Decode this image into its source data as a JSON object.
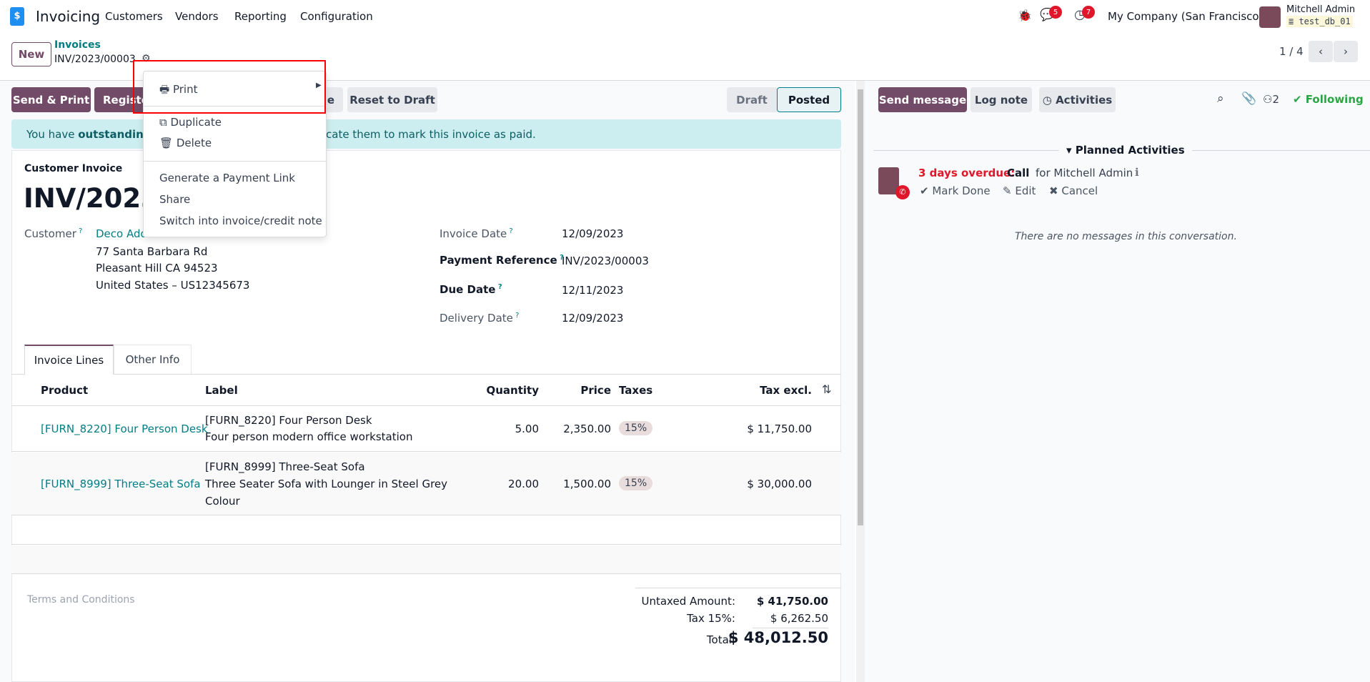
{
  "nav": {
    "app": "Invoicing",
    "menu": [
      "Customers",
      "Vendors",
      "Reporting",
      "Configuration"
    ],
    "chat_count": "5",
    "activity_count": "7",
    "company": "My Company (San Francisco)",
    "user": "Mitchell Admin",
    "db": "test_db_01"
  },
  "control": {
    "new": "New",
    "breadcrumb": "Invoices",
    "record": "INV/2023/00003",
    "pager": "1 / 4"
  },
  "actions": {
    "send_print": "Send & Print",
    "register": "Registe",
    "third": "ce",
    "reset": "Reset to Draft"
  },
  "status": {
    "items": [
      "Draft",
      "Posted"
    ],
    "active": "Posted"
  },
  "alert": {
    "pre": "You have ",
    "bold": "outstanding c",
    "post": "cate them to mark this invoice as paid."
  },
  "menu": {
    "print": "Print",
    "duplicate": "Duplicate",
    "delete": "Delete",
    "payment_link": "Generate a Payment Link",
    "share": "Share",
    "switch": "Switch into invoice/credit note"
  },
  "form": {
    "type": "Customer Invoice",
    "name": "INV/2023/",
    "customer_label": "Customer",
    "customer": "Deco Add",
    "address": [
      "77 Santa Barbara Rd",
      "Pleasant Hill CA 94523",
      "United States – US12345673"
    ],
    "fields": [
      {
        "label": "Invoice Date",
        "value": "12/09/2023",
        "bold": false
      },
      {
        "label": "Payment Reference",
        "value": "INV/2023/00003",
        "bold": true
      },
      {
        "label": "Due Date",
        "value": "12/11/2023",
        "bold": true
      },
      {
        "label": "Delivery Date",
        "value": "12/09/2023",
        "bold": false
      }
    ]
  },
  "tabs": [
    "Invoice Lines",
    "Other Info"
  ],
  "table": {
    "headers": {
      "product": "Product",
      "label": "Label",
      "quantity": "Quantity",
      "price": "Price",
      "taxes": "Taxes",
      "tax_excl": "Tax excl."
    },
    "rows": [
      {
        "product": "[FURN_8220] Four Person Desk",
        "label": [
          "[FURN_8220] Four Person Desk",
          "Four person modern office workstation"
        ],
        "quantity": "5.00",
        "price": "2,350.00",
        "tax": "15%",
        "subtotal": "$ 11,750.00"
      },
      {
        "product": "[FURN_8999] Three-Seat Sofa",
        "label": [
          "[FURN_8999] Three-Seat Sofa",
          "Three Seater Sofa with Lounger in Steel Grey",
          "Colour"
        ],
        "quantity": "20.00",
        "price": "1,500.00",
        "tax": "15%",
        "subtotal": "$ 30,000.00"
      }
    ]
  },
  "terms": "Terms and Conditions",
  "totals": {
    "untaxed_label": "Untaxed Amount:",
    "untaxed": "$ 41,750.00",
    "tax_label": "Tax 15%:",
    "tax": "$ 6,262.50",
    "total_label": "Total:",
    "total": "$ 48,012.50"
  },
  "chatter": {
    "send": "Send message",
    "log": "Log note",
    "activities": "Activities",
    "followers": "2",
    "following": "Following",
    "planned": "Planned Activities",
    "overdue": "3 days overdue:",
    "activity_type": "Call",
    "for": "for Mitchell Admin",
    "mark_done": "Mark Done",
    "edit": "Edit",
    "cancel": "Cancel",
    "empty": "There are no messages in this conversation."
  }
}
